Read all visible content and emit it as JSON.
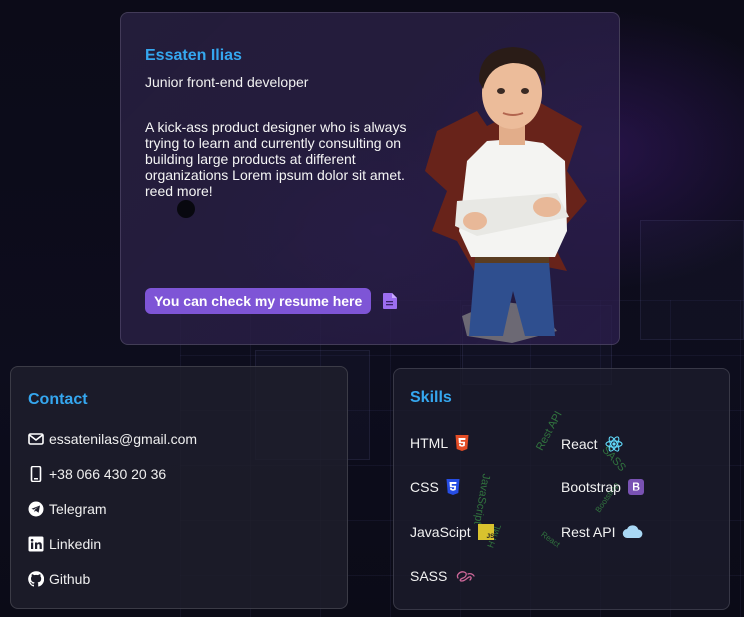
{
  "hero": {
    "name": "Essaten Ilias",
    "role": "Junior front-end developer",
    "bio": "A kick-ass product designer who is always trying to learn and currently consulting on building large products at different organizations Lorem ipsum dolor sit amet. reed more!",
    "resume_button": "You can check my resume here",
    "resume_icon": "file-icon"
  },
  "contact": {
    "title": "Contact",
    "items": [
      {
        "icon": "envelope-icon",
        "label": "essatenilas@gmail.com"
      },
      {
        "icon": "phone-icon",
        "label": "+38 066 430 20 36"
      },
      {
        "icon": "telegram-icon",
        "label": "Telegram"
      },
      {
        "icon": "linkedin-icon",
        "label": "Linkedin"
      },
      {
        "icon": "github-icon",
        "label": "Github"
      }
    ]
  },
  "skills": {
    "title": "Skills",
    "items": [
      {
        "label": "HTML",
        "icon": "html5-icon"
      },
      {
        "label": "React",
        "icon": "react-icon"
      },
      {
        "label": "CSS",
        "icon": "css3-icon"
      },
      {
        "label": "Bootstrap",
        "icon": "bootstrap-icon"
      },
      {
        "label": "JavaScipt",
        "icon": "javascript-icon"
      },
      {
        "label": "Rest API",
        "icon": "cloud-icon"
      },
      {
        "label": "SASS",
        "icon": "sass-icon"
      }
    ],
    "scatter_words": [
      "Rest API",
      "SASS",
      "JavaScript",
      "HTML",
      "Bootstrap",
      "React"
    ]
  },
  "colors": {
    "accent": "#35a7ef",
    "button": "#7e55d6",
    "html": "#e44d26",
    "css": "#264de4",
    "js": "#d9c22e",
    "react": "#61dafb",
    "bootstrap": "#7952b3",
    "cloud": "#a9d8f5",
    "sass": "#cd6799"
  }
}
